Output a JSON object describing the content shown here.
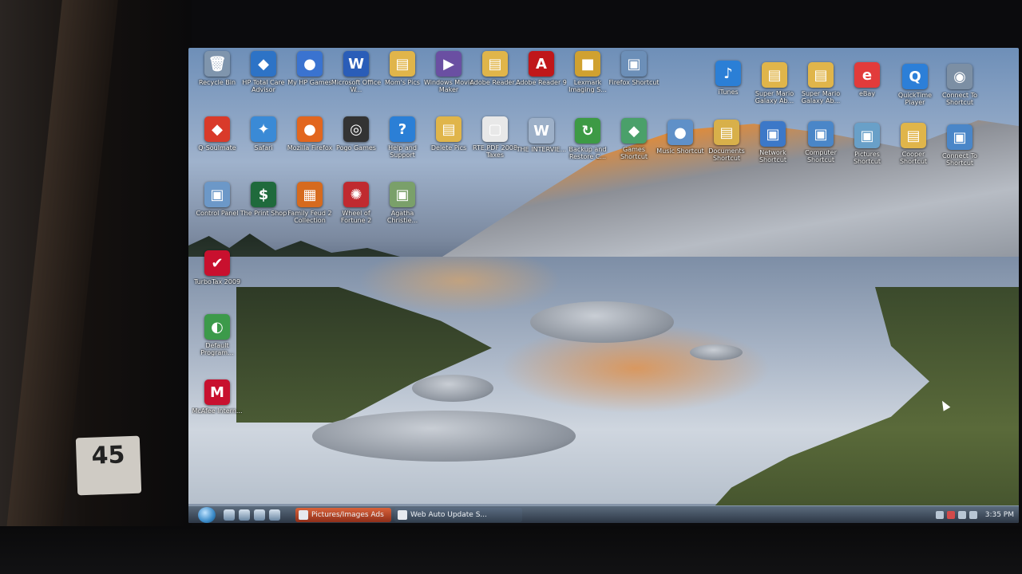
{
  "room": {
    "price_tag": "45"
  },
  "desktop": {
    "icons": [
      {
        "label": "Recycle Bin",
        "glyph": "🗑",
        "color": "#7f95ad"
      },
      {
        "label": "HP Total Care Advisor",
        "glyph": "◆",
        "color": "#2d73c6"
      },
      {
        "label": "My HP Games",
        "glyph": "●",
        "color": "#3a73d0"
      },
      {
        "label": "Microsoft Office W...",
        "glyph": "W",
        "color": "#2a5db8"
      },
      {
        "label": "Mom's Pics",
        "glyph": "▤",
        "color": "#e0b54a"
      },
      {
        "label": "Windows Movie Maker",
        "glyph": "▶",
        "color": "#6a4fa2"
      },
      {
        "label": "Adobe Reader...",
        "glyph": "▤",
        "color": "#e0b54a"
      },
      {
        "label": "Adobe Reader 9",
        "glyph": "A",
        "color": "#c0171a"
      },
      {
        "label": "Lexmark Imaging S...",
        "glyph": "■",
        "color": "#d0a130"
      },
      {
        "label": "Firefox Shortcut",
        "glyph": "▣",
        "color": "#6c8fb8"
      },
      {
        "label": "iTunes",
        "glyph": "♪",
        "color": "#2b7fd6"
      },
      {
        "label": "Super Mario Galaxy Ab...",
        "glyph": "▤",
        "color": "#e0b54a"
      },
      {
        "label": "Super Mario Galaxy Ab...",
        "glyph": "▤",
        "color": "#e0b54a"
      },
      {
        "label": "eBay",
        "glyph": "e",
        "color": "#e23b3b"
      },
      {
        "label": "QuickTime Player",
        "glyph": "Q",
        "color": "#2c7fd8"
      },
      {
        "label": "Connect To Shortcut",
        "glyph": "◉",
        "color": "#7c8fa4"
      },
      {
        "label": "Q-Soulmate",
        "glyph": "◆",
        "color": "#d93a2a"
      },
      {
        "label": "Safari",
        "glyph": "✦",
        "color": "#3a8ad6"
      },
      {
        "label": "Mozilla Firefox",
        "glyph": "●",
        "color": "#e2661e"
      },
      {
        "label": "Pogo Games",
        "glyph": "◎",
        "color": "#333333"
      },
      {
        "label": "Help and Support",
        "glyph": "?",
        "color": "#2b7fd6"
      },
      {
        "label": "Delete Pics",
        "glyph": "▤",
        "color": "#e0b54a"
      },
      {
        "label": "RTE.PDF 2008 Taxes",
        "glyph": "▢",
        "color": "#e8e8e8"
      },
      {
        "label": "THE INTERVIE...",
        "glyph": "W",
        "color": "#9db0c8"
      },
      {
        "label": "Backup and Restore C...",
        "glyph": "↻",
        "color": "#3d9a45"
      },
      {
        "label": "Games Shortcut",
        "glyph": "◆",
        "color": "#4aa06a"
      },
      {
        "label": "Music Shortcut",
        "glyph": "●",
        "color": "#5f90c8"
      },
      {
        "label": "Documents Shortcut",
        "glyph": "▤",
        "color": "#d8b04a"
      },
      {
        "label": "Network Shortcut",
        "glyph": "▣",
        "color": "#3c78c8"
      },
      {
        "label": "Computer Shortcut",
        "glyph": "▣",
        "color": "#4a86c8"
      },
      {
        "label": "Pictures Shortcut",
        "glyph": "▣",
        "color": "#69a0c8"
      },
      {
        "label": "Cooper Shortcut",
        "glyph": "▤",
        "color": "#e0b54a"
      },
      {
        "label": "Connect To Shortcut",
        "glyph": "▣",
        "color": "#4a86c8"
      },
      {
        "label": "Control Panel",
        "glyph": "▣",
        "color": "#6c98c8"
      },
      {
        "label": "The Print Shop",
        "glyph": "$",
        "color": "#1f6a3c"
      },
      {
        "label": "Family Feud 2 Collection",
        "glyph": "▦",
        "color": "#d66a1e"
      },
      {
        "label": "Wheel of Fortune 2",
        "glyph": "✺",
        "color": "#c02a30"
      },
      {
        "label": "Agatha Christie...",
        "glyph": "▣",
        "color": "#7aa06a"
      },
      {
        "label": "TurboTax 2009",
        "glyph": "✔",
        "color": "#c8102e"
      },
      {
        "label": "Default Program...",
        "glyph": "◐",
        "color": "#3c9a4a"
      },
      {
        "label": "McAfee Intern...",
        "glyph": "M",
        "color": "#c8102e"
      }
    ]
  },
  "taskbar": {
    "tasks": [
      {
        "label": "Pictures/Images Ads"
      },
      {
        "label": "Web Auto Update S..."
      }
    ],
    "clock": "3:35 PM"
  }
}
